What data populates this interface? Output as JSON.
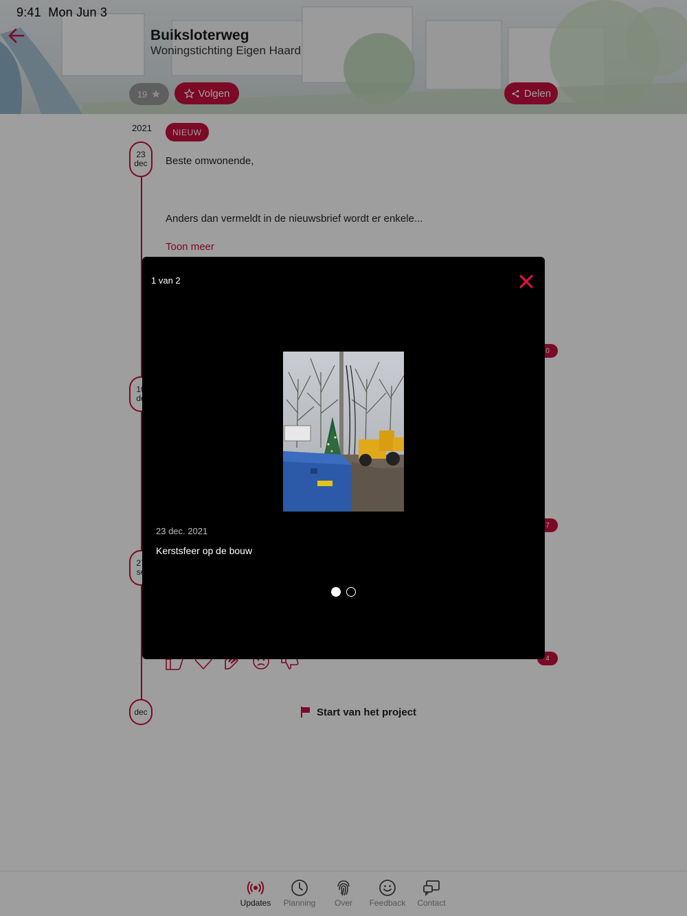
{
  "status": {
    "time": "9:41",
    "date": "Mon Jun 3"
  },
  "project": {
    "title": "Buiksloterweg",
    "subtitle": "Woningstichting Eigen Haard",
    "follower_count": "19",
    "follow_label": "Volgen",
    "share_label": "Delen"
  },
  "timeline": {
    "year": "2021",
    "post": {
      "badge": "NIEUW",
      "day": "23",
      "month": "dec",
      "greeting": "Beste omwonende,",
      "excerpt": "Anders dan vermeldt in de nieuwsbrief wordt er enkele...",
      "show_more": "Toon meer"
    },
    "bubbles": [
      {
        "day": "10",
        "month": "de"
      },
      {
        "day": "27",
        "month": "se"
      }
    ],
    "counts": [
      "0",
      "7",
      "4"
    ],
    "last_bubble": "dec",
    "milestone": "Start van het project"
  },
  "modal": {
    "counter": "1 van 2",
    "caption_date": "23 dec. 2021",
    "caption_text": "Kerstsfeer op de bouw",
    "total": 2,
    "current": 1
  },
  "nav": [
    {
      "label": "Updates",
      "icon": "broadcast-icon",
      "active": true
    },
    {
      "label": "Planning",
      "icon": "clock-icon",
      "active": false
    },
    {
      "label": "Over",
      "icon": "fingerprint-icon",
      "active": false
    },
    {
      "label": "Feedback",
      "icon": "smiley-icon",
      "active": false
    },
    {
      "label": "Contact",
      "icon": "chat-screen-icon",
      "active": false
    }
  ],
  "colors": {
    "accent": "#c8103e",
    "overlay": "#000000"
  }
}
